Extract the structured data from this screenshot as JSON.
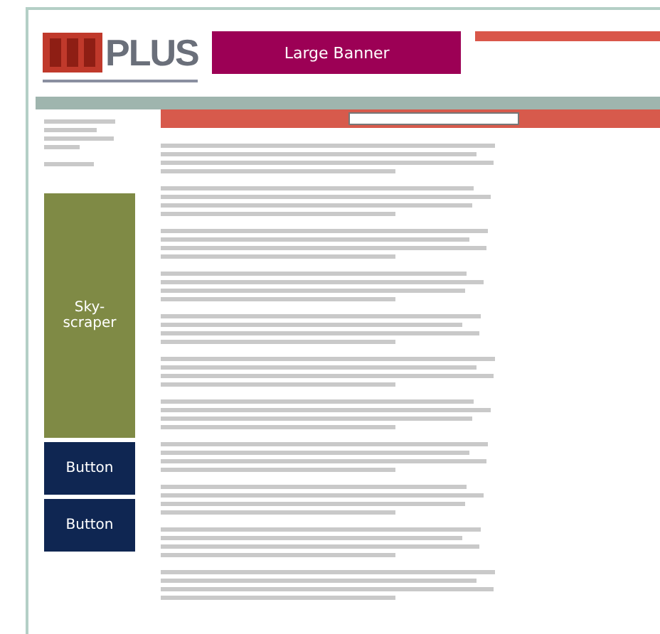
{
  "logo": {
    "text": "PLUS"
  },
  "banner": {
    "label": "Large Banner"
  },
  "skyscraper": {
    "label": "Sky-scraper"
  },
  "buttons": [
    {
      "label": "Button"
    },
    {
      "label": "Button"
    }
  ]
}
